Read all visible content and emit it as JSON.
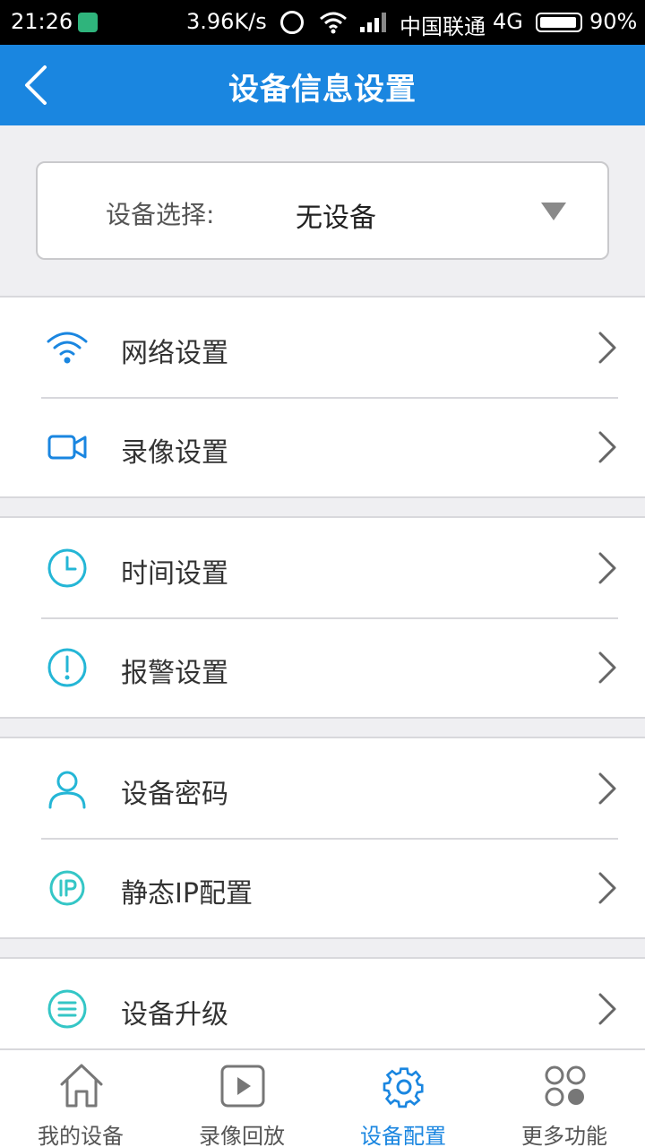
{
  "status_bar": {
    "time": "21:26",
    "net_speed": "3.96K/s",
    "carrier": "中国联通",
    "network": "4G",
    "battery": "90%"
  },
  "header": {
    "title": "设备信息设置"
  },
  "device_select": {
    "label": "设备选择:",
    "value": "无设备"
  },
  "menu": {
    "network": "网络设置",
    "record": "录像设置",
    "time": "时间设置",
    "alarm": "报警设置",
    "password": "设备密码",
    "static_ip": "静态IP配置",
    "upgrade": "设备升级"
  },
  "tabs": {
    "my_devices": "我的设备",
    "playback": "录像回放",
    "config": "设备配置",
    "more": "更多功能"
  },
  "colors": {
    "accent": "#1a86e0",
    "icon_cyan": "#24b6d6"
  }
}
